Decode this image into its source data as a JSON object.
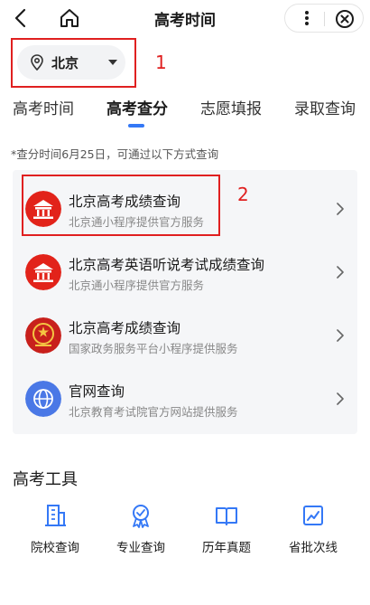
{
  "header": {
    "title": "高考时间",
    "back_icon": "back-arrow-icon",
    "home_icon": "home-icon",
    "more_icon": "more-vertical-icon",
    "close_icon": "circle-close-icon"
  },
  "city_selector": {
    "label": "北京",
    "pin_icon": "location-pin-icon",
    "caret_icon": "caret-down-icon"
  },
  "annotations": [
    "1",
    "2"
  ],
  "tabs": [
    {
      "label": "高考时间",
      "active": false
    },
    {
      "label": "高考查分",
      "active": true
    },
    {
      "label": "志愿填报",
      "active": false
    },
    {
      "label": "录取查询",
      "active": false
    }
  ],
  "notice": "*查分时间6月25日，可通过以下方式查询",
  "services": [
    {
      "title": "北京高考成绩查询",
      "subtitle": "北京通小程序提供官方服务",
      "icon": "temple-icon"
    },
    {
      "title": "北京高考英语听说考试成绩查询",
      "subtitle": "北京通小程序提供官方服务",
      "icon": "temple-icon"
    },
    {
      "title": "北京高考成绩查询",
      "subtitle": "国家政务服务平台小程序提供服务",
      "icon": "national-emblem-icon"
    },
    {
      "title": "官网查询",
      "subtitle": "北京教育考试院官方网站提供服务",
      "icon": "globe-icon"
    }
  ],
  "tools": {
    "title": "高考工具",
    "items": [
      {
        "label": "院校查询",
        "icon": "building-icon"
      },
      {
        "label": "专业查询",
        "icon": "award-ribbon-icon"
      },
      {
        "label": "历年真题",
        "icon": "open-book-icon"
      },
      {
        "label": "省批次线",
        "icon": "trend-chart-icon"
      }
    ]
  },
  "colors": {
    "accent": "#3478f6",
    "annotation_red": "#e02020",
    "temple_red": "#e2231a"
  }
}
